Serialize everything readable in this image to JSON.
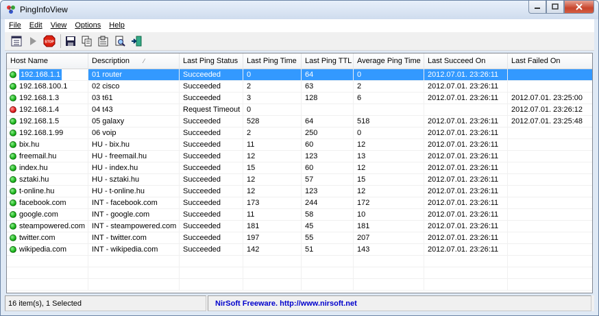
{
  "window": {
    "title": "PingInfoView"
  },
  "menu": [
    "File",
    "Edit",
    "View",
    "Options",
    "Help"
  ],
  "toolbar": {
    "buttons": [
      "properties-icon",
      "play-icon",
      "stop-icon",
      "save-icon",
      "copy-icon",
      "options-icon",
      "find-icon",
      "exit-icon"
    ]
  },
  "columns": [
    "Host Name",
    "Description",
    "Last Ping Status",
    "Last Ping Time",
    "Last Ping TTL",
    "Average Ping Time",
    "Last Succeed On",
    "Last Failed On"
  ],
  "rows": [
    {
      "status_color": "green",
      "host": "192.168.1.1",
      "desc": "01 router",
      "status": "Succeeded",
      "time": "0",
      "ttl": "64",
      "avg": "0",
      "succeed": "2012.07.01. 23:26:11",
      "failed": "",
      "selected": true
    },
    {
      "status_color": "green",
      "host": "192.168.100.1",
      "desc": "02 cisco",
      "status": "Succeeded",
      "time": "2",
      "ttl": "63",
      "avg": "2",
      "succeed": "2012.07.01. 23:26:11",
      "failed": ""
    },
    {
      "status_color": "green",
      "host": "192.168.1.3",
      "desc": "03 t61",
      "status": "Succeeded",
      "time": "3",
      "ttl": "128",
      "avg": "6",
      "succeed": "2012.07.01. 23:26:11",
      "failed": "2012.07.01. 23:25:00"
    },
    {
      "status_color": "red",
      "host": "192.168.1.4",
      "desc": "04 t43",
      "status": "Request Timeout",
      "time": "0",
      "ttl": "",
      "avg": "",
      "succeed": "",
      "failed": "2012.07.01. 23:26:12"
    },
    {
      "status_color": "green",
      "host": "192.168.1.5",
      "desc": "05 galaxy",
      "status": "Succeeded",
      "time": "528",
      "ttl": "64",
      "avg": "518",
      "succeed": "2012.07.01. 23:26:11",
      "failed": "2012.07.01. 23:25:48"
    },
    {
      "status_color": "green",
      "host": "192.168.1.99",
      "desc": "06 voip",
      "status": "Succeeded",
      "time": "2",
      "ttl": "250",
      "avg": "0",
      "succeed": "2012.07.01. 23:26:11",
      "failed": ""
    },
    {
      "status_color": "green",
      "host": "bix.hu",
      "desc": "HU - bix.hu",
      "status": "Succeeded",
      "time": "11",
      "ttl": "60",
      "avg": "12",
      "succeed": "2012.07.01. 23:26:11",
      "failed": ""
    },
    {
      "status_color": "green",
      "host": "freemail.hu",
      "desc": "HU - freemail.hu",
      "status": "Succeeded",
      "time": "12",
      "ttl": "123",
      "avg": "13",
      "succeed": "2012.07.01. 23:26:11",
      "failed": ""
    },
    {
      "status_color": "green",
      "host": "index.hu",
      "desc": "HU - index.hu",
      "status": "Succeeded",
      "time": "15",
      "ttl": "60",
      "avg": "12",
      "succeed": "2012.07.01. 23:26:11",
      "failed": ""
    },
    {
      "status_color": "green",
      "host": "sztaki.hu",
      "desc": "HU - sztaki.hu",
      "status": "Succeeded",
      "time": "12",
      "ttl": "57",
      "avg": "15",
      "succeed": "2012.07.01. 23:26:11",
      "failed": ""
    },
    {
      "status_color": "green",
      "host": "t-online.hu",
      "desc": "HU - t-online.hu",
      "status": "Succeeded",
      "time": "12",
      "ttl": "123",
      "avg": "12",
      "succeed": "2012.07.01. 23:26:11",
      "failed": ""
    },
    {
      "status_color": "green",
      "host": "facebook.com",
      "desc": "INT - facebook.com",
      "status": "Succeeded",
      "time": "173",
      "ttl": "244",
      "avg": "172",
      "succeed": "2012.07.01. 23:26:11",
      "failed": ""
    },
    {
      "status_color": "green",
      "host": "google.com",
      "desc": "INT - google.com",
      "status": "Succeeded",
      "time": "11",
      "ttl": "58",
      "avg": "10",
      "succeed": "2012.07.01. 23:26:11",
      "failed": ""
    },
    {
      "status_color": "green",
      "host": "steampowered.com",
      "desc": "INT - steampowered.com",
      "status": "Succeeded",
      "time": "181",
      "ttl": "45",
      "avg": "181",
      "succeed": "2012.07.01. 23:26:11",
      "failed": ""
    },
    {
      "status_color": "green",
      "host": "twitter.com",
      "desc": "INT - twitter.com",
      "status": "Succeeded",
      "time": "197",
      "ttl": "55",
      "avg": "207",
      "succeed": "2012.07.01. 23:26:11",
      "failed": ""
    },
    {
      "status_color": "green",
      "host": "wikipedia.com",
      "desc": "INT - wikipedia.com",
      "status": "Succeeded",
      "time": "142",
      "ttl": "51",
      "avg": "143",
      "succeed": "2012.07.01. 23:26:11",
      "failed": ""
    }
  ],
  "statusbar": {
    "count": "16 item(s), 1 Selected",
    "link": "NirSoft Freeware.  http://www.nirsoft.net"
  },
  "colors": {
    "selection": "#3399ff",
    "link": "#0000cc",
    "ok": "#18b318",
    "fail": "#e01818"
  }
}
